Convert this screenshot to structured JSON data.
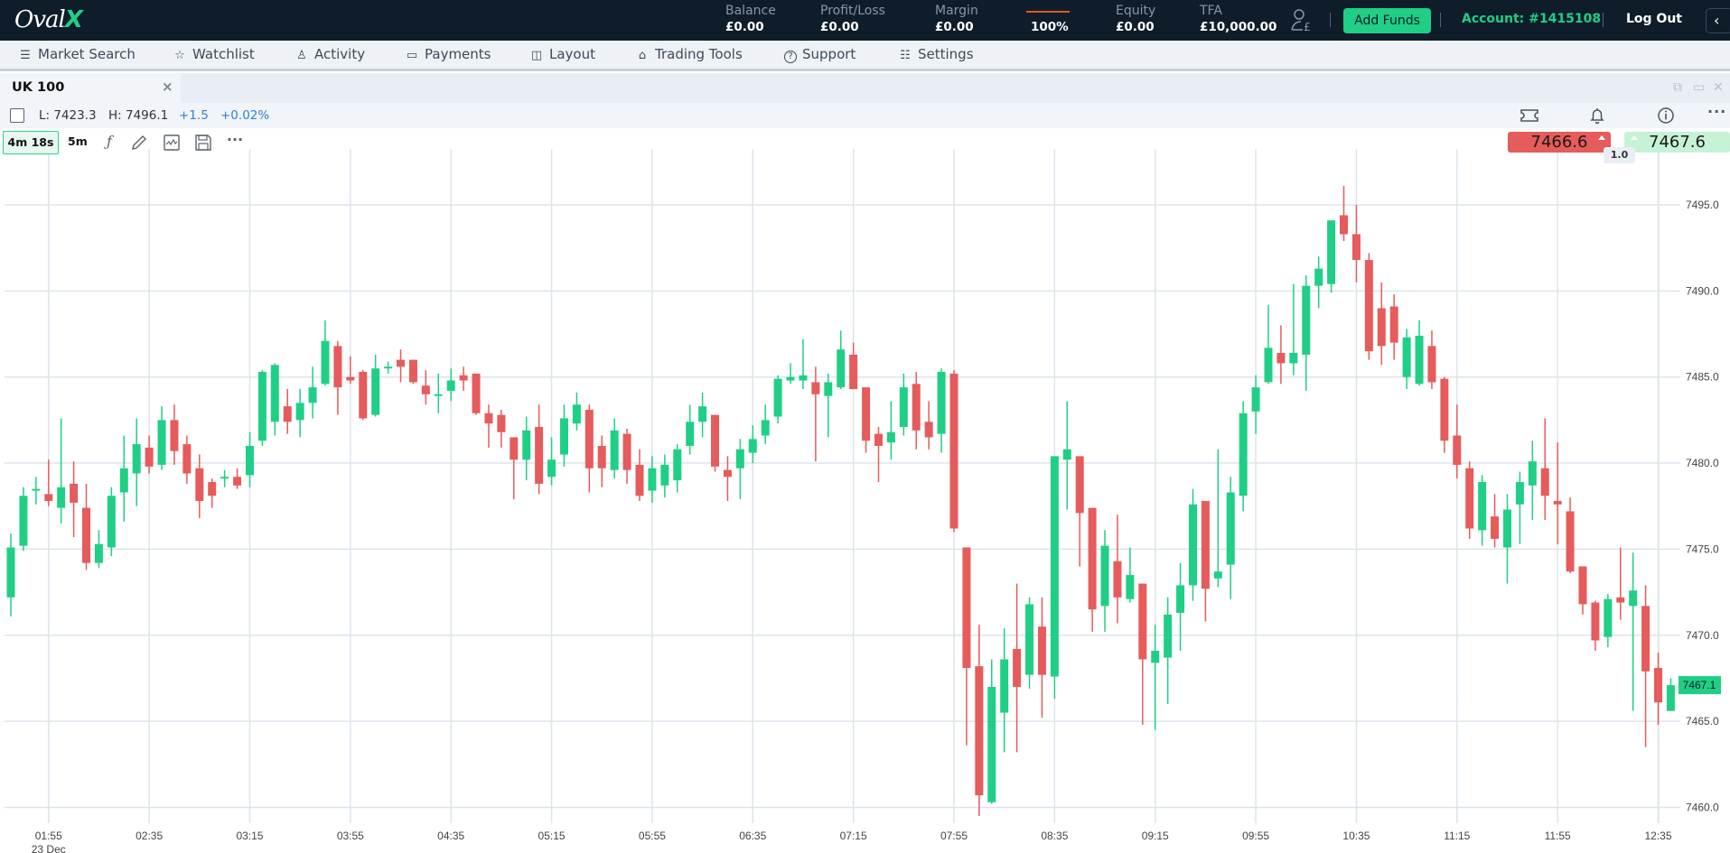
{
  "brand": {
    "logo_text": "Oval",
    "logo_accent": "X"
  },
  "topbar": {
    "stats": [
      {
        "label": "Balance",
        "value": "£0.00"
      },
      {
        "label": "Profit/Loss",
        "value": "£0.00"
      },
      {
        "label": "Margin",
        "value": "£0.00"
      },
      {
        "label": "",
        "value": "100%"
      },
      {
        "label": "Equity",
        "value": "£0.00"
      },
      {
        "label": "TFA",
        "value": "£10,000.00"
      }
    ],
    "add_funds_label": "Add Funds",
    "account_label": "Account: #1415108",
    "logout_label": "Log Out",
    "collapse_icon": "chevron-left-icon",
    "colors": {
      "bg": "#0f1c2a",
      "accent": "#1fcf86",
      "margin_bar": "#e8552a"
    }
  },
  "menu": {
    "items": [
      {
        "label": "Market Search",
        "icon": "search-list-icon",
        "glyph": "☰"
      },
      {
        "label": "Watchlist",
        "icon": "star-icon",
        "glyph": "☆"
      },
      {
        "label": "Activity",
        "icon": "user-icon",
        "glyph": "♙"
      },
      {
        "label": "Payments",
        "icon": "card-icon",
        "glyph": "▭"
      },
      {
        "label": "Layout",
        "icon": "layout-icon",
        "glyph": "◫"
      },
      {
        "label": "Trading Tools",
        "icon": "graduation-cap-icon",
        "glyph": "⌂"
      },
      {
        "label": "Support",
        "icon": "help-circle-icon",
        "glyph": "?"
      },
      {
        "label": "Settings",
        "icon": "sliders-icon",
        "glyph": "☷"
      }
    ]
  },
  "tab": {
    "title": "UK 100",
    "close_glyph": "×"
  },
  "window_controls": {
    "popout": "⧉",
    "maximize": "▭",
    "close": "✕"
  },
  "info": {
    "low": "L: 7423.3",
    "high": "H: 7496.1",
    "change": "+1.5",
    "change_pct": "+0.02%",
    "right_icons": [
      "ticket-icon",
      "bell-icon",
      "info-icon",
      "more-icon"
    ]
  },
  "toolbar": {
    "timer": "4m 18s",
    "timeframe": "5m",
    "tools": [
      "function-icon",
      "pencil-icon",
      "indicator-icon",
      "save-icon",
      "more-icon"
    ]
  },
  "quote": {
    "sell": "7466.6",
    "buy": "7467.6",
    "spread": "1.0",
    "colors": {
      "sell": "#e65b5b",
      "buy": "#c6f2d6"
    }
  },
  "chart_data": {
    "type": "candlestick",
    "title": "UK 100",
    "interval": "5m",
    "xlabel": "",
    "ylabel": "",
    "ylim": [
      7458.2,
      7498.2
    ],
    "grid": true,
    "y_ticks": [
      "7495.0",
      "7490.0",
      "7485.0",
      "7480.0",
      "7475.0",
      "7470.0",
      "7465.0",
      "7460.0"
    ],
    "y_tick_values": [
      7495,
      7490,
      7485,
      7480,
      7475,
      7470,
      7465,
      7460
    ],
    "x_ticks": [
      {
        "label": "01:55",
        "sub": "23 Dec",
        "index": 3
      },
      {
        "label": "02:35",
        "index": 11
      },
      {
        "label": "03:15",
        "index": 19
      },
      {
        "label": "03:55",
        "index": 27
      },
      {
        "label": "04:35",
        "index": 35
      },
      {
        "label": "05:15",
        "index": 43
      },
      {
        "label": "05:55",
        "index": 51
      },
      {
        "label": "06:35",
        "index": 59
      },
      {
        "label": "07:15",
        "index": 67
      },
      {
        "label": "07:55",
        "index": 75
      },
      {
        "label": "08:35",
        "index": 83
      },
      {
        "label": "09:15",
        "index": 91
      },
      {
        "label": "09:55",
        "index": 99
      },
      {
        "label": "10:35",
        "index": 107
      },
      {
        "label": "11:15",
        "index": 115
      },
      {
        "label": "11:55",
        "index": 123
      },
      {
        "label": "12:35",
        "index": 131
      }
    ],
    "last_price": "7467.1",
    "last_value": 7467.1,
    "colors": {
      "up": "#20cf86",
      "down": "#e65b5b",
      "grid": "#dde4ee"
    },
    "ohlc": [
      [
        7472.2,
        7475.9,
        7471.1,
        7475.1
      ],
      [
        7475.2,
        7478.6,
        7474.9,
        7478.1
      ],
      [
        7478.4,
        7479.2,
        7477.6,
        7478.5
      ],
      [
        7478.2,
        7480.2,
        7477.5,
        7477.8
      ],
      [
        7477.4,
        7482.6,
        7476.5,
        7478.6
      ],
      [
        7478.8,
        7480.1,
        7475.7,
        7477.7
      ],
      [
        7477.4,
        7478.8,
        7473.8,
        7474.2
      ],
      [
        7474.2,
        7476.1,
        7473.9,
        7475.3
      ],
      [
        7475.1,
        7478.6,
        7474.6,
        7478.1
      ],
      [
        7478.3,
        7481.6,
        7476.6,
        7479.7
      ],
      [
        7479.4,
        7482.6,
        7477.5,
        7481.1
      ],
      [
        7480.9,
        7481.6,
        7479.4,
        7479.8
      ],
      [
        7479.9,
        7483.3,
        7479.6,
        7482.5
      ],
      [
        7482.5,
        7483.4,
        7479.9,
        7480.7
      ],
      [
        7481.1,
        7481.6,
        7478.8,
        7479.4
      ],
      [
        7479.7,
        7480.5,
        7476.8,
        7477.8
      ],
      [
        7478.9,
        7479.1,
        7477.4,
        7478.1
      ],
      [
        7479.1,
        7479.6,
        7478.6,
        7479.2
      ],
      [
        7479.2,
        7479.7,
        7478.5,
        7478.7
      ],
      [
        7479.3,
        7481.8,
        7478.6,
        7481.0
      ],
      [
        7481.3,
        7485.4,
        7481.0,
        7485.3
      ],
      [
        7482.4,
        7485.8,
        7481.6,
        7485.7
      ],
      [
        7483.3,
        7484.3,
        7481.7,
        7482.4
      ],
      [
        7482.5,
        7484.3,
        7481.5,
        7483.5
      ],
      [
        7483.5,
        7485.6,
        7482.6,
        7484.4
      ],
      [
        7484.6,
        7488.3,
        7484.5,
        7487.1
      ],
      [
        7486.8,
        7487.1,
        7482.8,
        7484.4
      ],
      [
        7485.0,
        7486.2,
        7484.6,
        7484.8
      ],
      [
        7485.3,
        7485.4,
        7482.5,
        7482.6
      ],
      [
        7482.8,
        7486.3,
        7482.7,
        7485.5
      ],
      [
        7485.5,
        7485.9,
        7485.2,
        7485.6
      ],
      [
        7486.0,
        7486.6,
        7484.7,
        7485.6
      ],
      [
        7486.0,
        7486.0,
        7484.6,
        7484.7
      ],
      [
        7484.5,
        7485.4,
        7483.4,
        7484.0
      ],
      [
        7483.9,
        7485.2,
        7482.9,
        7484.0
      ],
      [
        7484.2,
        7485.5,
        7483.6,
        7484.8
      ],
      [
        7485.1,
        7485.6,
        7484.2,
        7484.8
      ],
      [
        7485.2,
        7485.2,
        7482.8,
        7482.9
      ],
      [
        7482.9,
        7483.4,
        7480.9,
        7482.3
      ],
      [
        7482.8,
        7483.1,
        7480.9,
        7481.8
      ],
      [
        7481.5,
        7481.5,
        7477.9,
        7480.2
      ],
      [
        7480.2,
        7482.7,
        7479.0,
        7481.9
      ],
      [
        7482.1,
        7483.4,
        7478.2,
        7478.8
      ],
      [
        7479.2,
        7481.5,
        7478.7,
        7480.2
      ],
      [
        7480.5,
        7483.4,
        7479.8,
        7482.6
      ],
      [
        7482.3,
        7484.1,
        7481.9,
        7483.4
      ],
      [
        7483.1,
        7483.4,
        7478.3,
        7479.7
      ],
      [
        7481.0,
        7481.6,
        7478.6,
        7479.7
      ],
      [
        7479.6,
        7482.6,
        7479.1,
        7481.9
      ],
      [
        7481.7,
        7482.0,
        7478.8,
        7479.6
      ],
      [
        7479.9,
        7480.8,
        7477.8,
        7478.1
      ],
      [
        7478.4,
        7480.4,
        7477.7,
        7479.7
      ],
      [
        7478.7,
        7480.5,
        7478.0,
        7479.9
      ],
      [
        7479.0,
        7481.1,
        7478.3,
        7480.8
      ],
      [
        7481.0,
        7483.4,
        7480.5,
        7482.4
      ],
      [
        7482.4,
        7484.1,
        7481.5,
        7483.3
      ],
      [
        7482.8,
        7482.8,
        7479.5,
        7479.8
      ],
      [
        7479.6,
        7480.4,
        7477.8,
        7479.2
      ],
      [
        7479.7,
        7481.4,
        7477.9,
        7480.8
      ],
      [
        7480.6,
        7482.2,
        7480.0,
        7481.4
      ],
      [
        7481.6,
        7483.4,
        7481.1,
        7482.5
      ],
      [
        7482.7,
        7485.1,
        7482.3,
        7484.9
      ],
      [
        7484.8,
        7485.8,
        7484.6,
        7485.0
      ],
      [
        7484.8,
        7487.2,
        7484.3,
        7485.1
      ],
      [
        7484.7,
        7485.6,
        7480.1,
        7484.0
      ],
      [
        7483.9,
        7485.2,
        7481.5,
        7484.7
      ],
      [
        7484.4,
        7487.7,
        7484.3,
        7486.6
      ],
      [
        7486.3,
        7487.0,
        7484.3,
        7484.3
      ],
      [
        7484.4,
        7484.4,
        7480.6,
        7481.3
      ],
      [
        7481.7,
        7482.1,
        7478.9,
        7481.0
      ],
      [
        7481.2,
        7483.6,
        7480.2,
        7481.8
      ],
      [
        7482.1,
        7485.2,
        7481.6,
        7484.4
      ],
      [
        7484.6,
        7485.3,
        7480.8,
        7481.9
      ],
      [
        7482.4,
        7483.6,
        7480.8,
        7481.5
      ],
      [
        7481.7,
        7485.5,
        7480.6,
        7485.3
      ],
      [
        7485.2,
        7485.4,
        7476.0,
        7476.2
      ],
      [
        7475.1,
        7475.1,
        7463.6,
        7468.1
      ],
      [
        7468.2,
        7470.6,
        7459.5,
        7460.7
      ],
      [
        7460.3,
        7468.6,
        7460.2,
        7467.0
      ],
      [
        7465.5,
        7470.4,
        7463.2,
        7468.6
      ],
      [
        7469.2,
        7473.0,
        7463.2,
        7467.0
      ],
      [
        7467.7,
        7472.2,
        7466.9,
        7471.8
      ],
      [
        7470.5,
        7472.2,
        7465.2,
        7467.7
      ],
      [
        7467.6,
        7480.4,
        7466.3,
        7480.4
      ],
      [
        7480.2,
        7483.6,
        7477.3,
        7480.8
      ],
      [
        7480.4,
        7480.4,
        7474.0,
        7477.1
      ],
      [
        7477.4,
        7477.4,
        7470.2,
        7471.5
      ],
      [
        7471.7,
        7476.1,
        7470.2,
        7475.2
      ],
      [
        7474.3,
        7477.0,
        7470.7,
        7472.2
      ],
      [
        7472.1,
        7475.1,
        7471.9,
        7473.5
      ],
      [
        7473.0,
        7473.0,
        7464.8,
        7468.6
      ],
      [
        7468.4,
        7470.6,
        7464.5,
        7469.1
      ],
      [
        7468.7,
        7472.2,
        7466.0,
        7471.2
      ],
      [
        7471.3,
        7474.2,
        7469.1,
        7472.9
      ],
      [
        7472.9,
        7478.5,
        7472.0,
        7477.6
      ],
      [
        7477.8,
        7477.8,
        7470.8,
        7472.7
      ],
      [
        7473.3,
        7480.8,
        7472.8,
        7473.7
      ],
      [
        7474.1,
        7479.2,
        7472.1,
        7478.3
      ],
      [
        7478.1,
        7483.6,
        7477.2,
        7482.9
      ],
      [
        7483.0,
        7485.1,
        7481.7,
        7484.4
      ],
      [
        7484.7,
        7489.2,
        7484.6,
        7486.7
      ],
      [
        7486.4,
        7488.0,
        7484.6,
        7485.8
      ],
      [
        7485.8,
        7490.4,
        7485.1,
        7486.4
      ],
      [
        7486.3,
        7490.9,
        7484.2,
        7490.3
      ],
      [
        7490.3,
        7492.0,
        7489.0,
        7491.3
      ],
      [
        7490.4,
        7494.1,
        7489.9,
        7494.1
      ],
      [
        7494.4,
        7496.1,
        7492.9,
        7493.3
      ],
      [
        7493.3,
        7495.0,
        7490.5,
        7491.8
      ],
      [
        7491.8,
        7492.2,
        7486.0,
        7486.5
      ],
      [
        7489.0,
        7490.5,
        7485.7,
        7486.8
      ],
      [
        7489.1,
        7489.8,
        7486.0,
        7487.0
      ],
      [
        7485.0,
        7487.8,
        7484.3,
        7487.3
      ],
      [
        7484.6,
        7488.3,
        7484.5,
        7487.4
      ],
      [
        7486.8,
        7487.7,
        7484.3,
        7484.7
      ],
      [
        7484.9,
        7485.0,
        7480.6,
        7481.3
      ],
      [
        7481.6,
        7483.4,
        7479.1,
        7479.9
      ],
      [
        7479.7,
        7480.1,
        7475.6,
        7476.2
      ],
      [
        7476.1,
        7479.3,
        7475.2,
        7478.9
      ],
      [
        7476.9,
        7478.2,
        7475.1,
        7475.6
      ],
      [
        7475.1,
        7478.2,
        7473.0,
        7477.3
      ],
      [
        7477.6,
        7479.5,
        7475.3,
        7478.9
      ],
      [
        7478.7,
        7481.3,
        7476.7,
        7480.1
      ],
      [
        7479.7,
        7482.6,
        7476.7,
        7478.1
      ],
      [
        7477.8,
        7481.2,
        7475.3,
        7477.6
      ],
      [
        7477.2,
        7478.0,
        7473.6,
        7473.7
      ],
      [
        7474.0,
        7474.0,
        7471.2,
        7471.8
      ],
      [
        7471.9,
        7472.0,
        7469.1,
        7469.7
      ],
      [
        7469.9,
        7472.4,
        7469.3,
        7472.1
      ],
      [
        7472.2,
        7475.1,
        7470.9,
        7471.9
      ],
      [
        7471.7,
        7474.8,
        7465.6,
        7472.6
      ],
      [
        7471.7,
        7472.9,
        7463.5,
        7467.9
      ],
      [
        7468.1,
        7469.0,
        7464.8,
        7466.1
      ],
      [
        7465.6,
        7467.5,
        7465.6,
        7467.1
      ]
    ]
  }
}
